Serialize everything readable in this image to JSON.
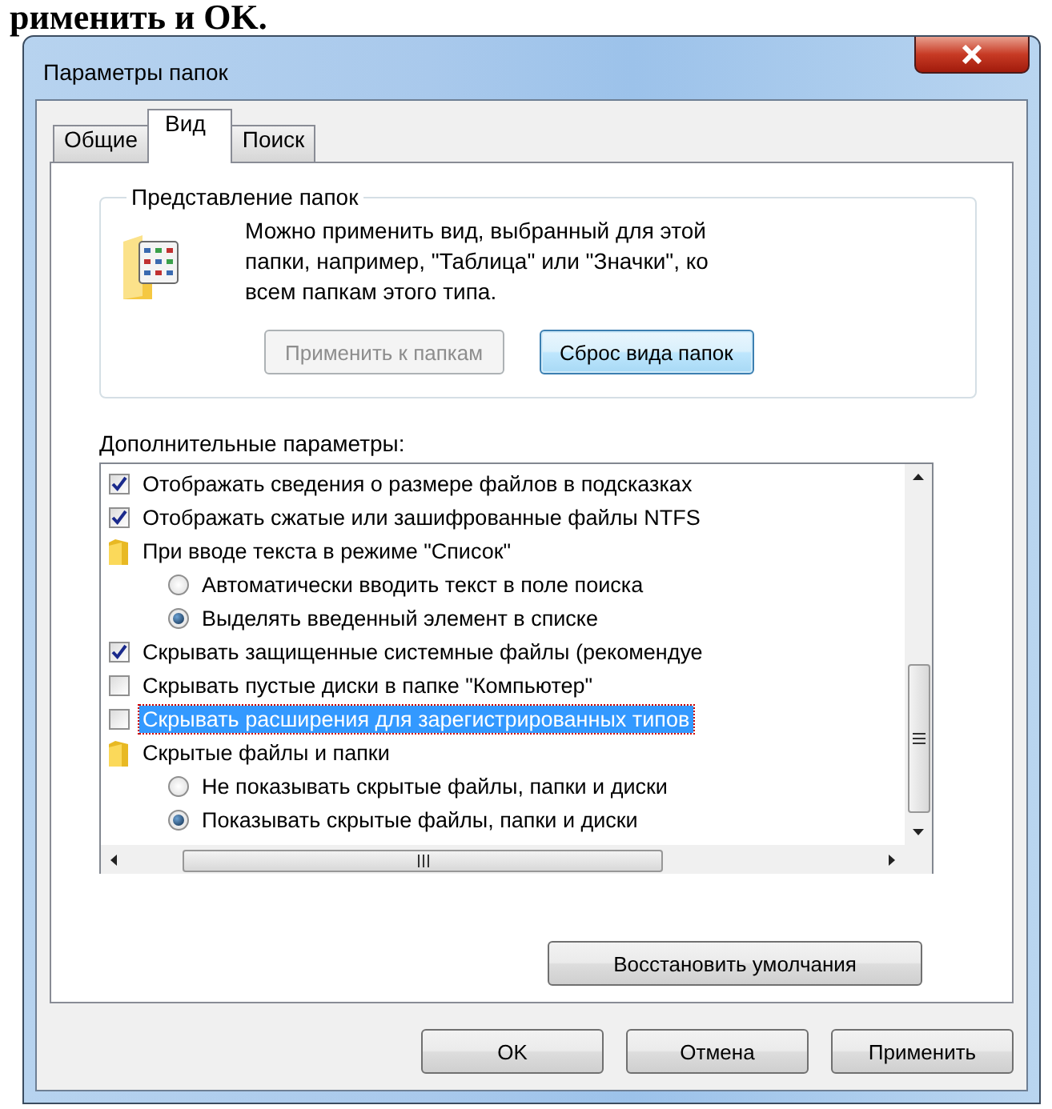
{
  "document_text": "рименить и OK.",
  "window": {
    "title": "Параметры папок"
  },
  "tabs": [
    {
      "label": "Общие",
      "selected": false
    },
    {
      "label": "Вид",
      "selected": true
    },
    {
      "label": "Поиск",
      "selected": false
    }
  ],
  "folder_views": {
    "title": "Представление папок",
    "description": "Можно применить вид, выбранный для этой папки, например, \"Таблица\" или \"Значки\", ко всем папкам этого типа.",
    "buttons": [
      {
        "label": "Применить к папкам",
        "disabled": true,
        "focused": false
      },
      {
        "label": "Сброс вида папок",
        "disabled": false,
        "focused": true
      }
    ]
  },
  "advanced": {
    "label": "Дополнительные параметры:",
    "options": [
      {
        "kind": "checkbox",
        "label": "Отображать сведения о размере файлов в подсказках",
        "checked": true,
        "selected": false
      },
      {
        "kind": "checkbox",
        "label": "Отображать сжатые или зашифрованные файлы NTFS",
        "checked": true,
        "selected": false
      },
      {
        "kind": "group",
        "label": "При вводе текста в режиме \"Список\"",
        "selected": false,
        "children": [
          {
            "kind": "radio",
            "label": "Автоматически вводить текст в поле поиска",
            "checked": false,
            "selected": false
          },
          {
            "kind": "radio",
            "label": "Выделять введенный элемент в списке",
            "checked": true,
            "selected": false
          }
        ]
      },
      {
        "kind": "checkbox",
        "label": "Скрывать защищенные системные файлы (рекомендуе",
        "checked": true,
        "selected": false
      },
      {
        "kind": "checkbox",
        "label": "Скрывать пустые диски в папке \"Компьютер\"",
        "checked": false,
        "selected": false
      },
      {
        "kind": "checkbox",
        "label": "Скрывать расширения для зарегистрированных типов",
        "checked": false,
        "selected": true
      },
      {
        "kind": "group",
        "label": "Скрытые файлы и папки",
        "selected": false,
        "children": [
          {
            "kind": "radio",
            "label": "Не показывать скрытые файлы, папки и диски",
            "checked": false,
            "selected": false
          },
          {
            "kind": "radio",
            "label": "Показывать скрытые файлы, папки и диски",
            "checked": true,
            "selected": false
          }
        ]
      }
    ]
  },
  "restore_button": "Восстановить умолчания",
  "buttons": [
    {
      "label": "OK"
    },
    {
      "label": "Отмена"
    },
    {
      "label": "Применить"
    }
  ]
}
